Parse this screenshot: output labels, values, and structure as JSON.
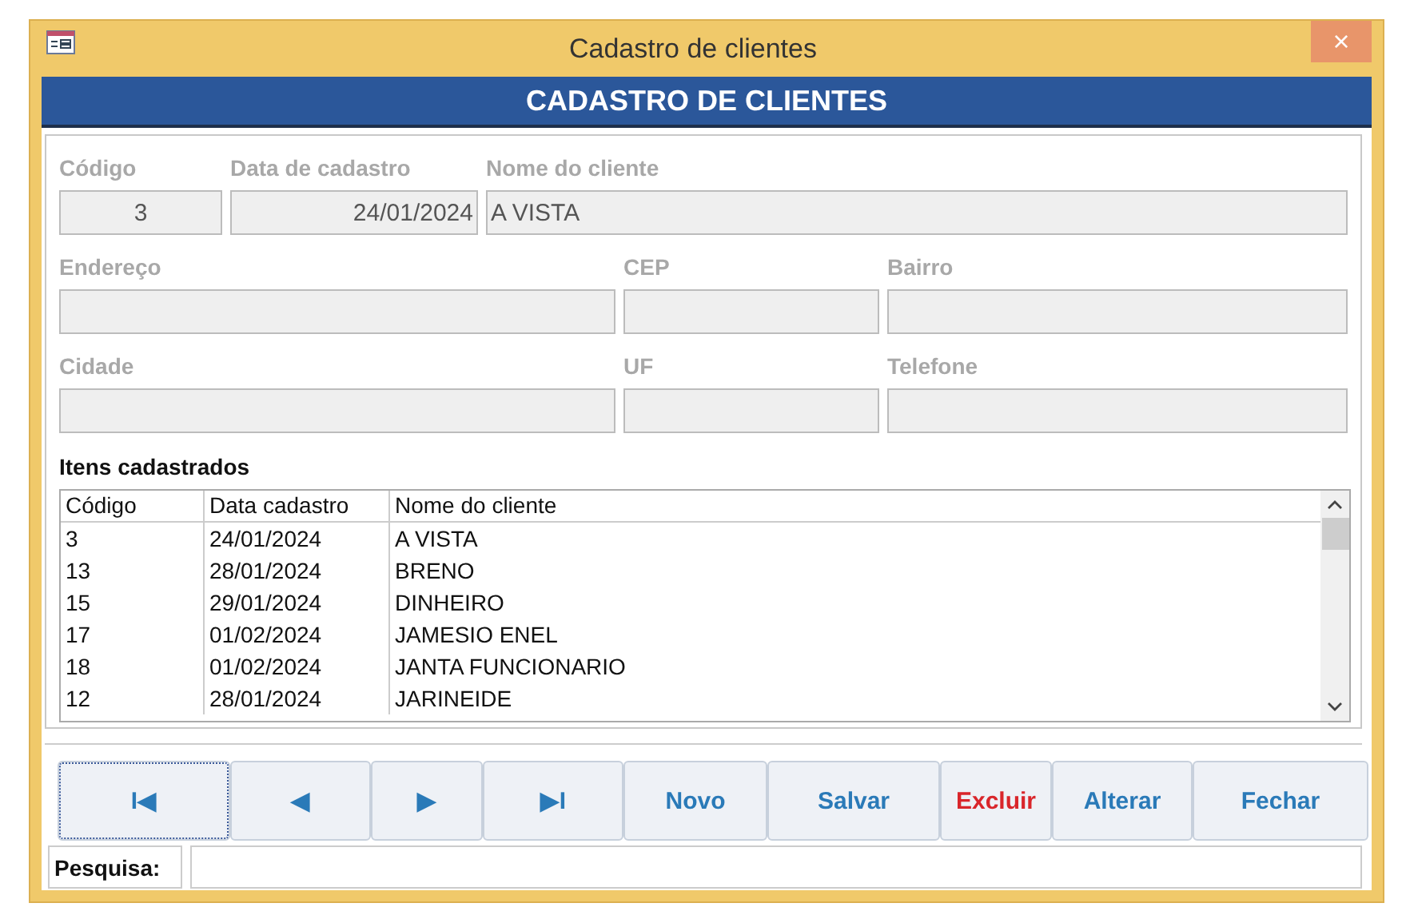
{
  "window": {
    "title": "Cadastro de clientes",
    "close": "×"
  },
  "header": "CADASTRO DE CLIENTES",
  "form": {
    "fields": [
      {
        "label": "Código",
        "value": "3",
        "disabled": true
      },
      {
        "label": "Data de cadastro",
        "value": "24/01/2024",
        "disabled": true
      },
      {
        "label": "Nome do cliente",
        "value": "A VISTA",
        "disabled": true
      },
      {
        "label": "Endereço",
        "disabled": true
      },
      {
        "label": "CEP",
        "disabled": true
      },
      {
        "label": "Bairro",
        "disabled": true
      },
      {
        "label": "Cidade",
        "disabled": true
      },
      {
        "label": "UF",
        "disabled": true
      },
      {
        "label": "Telefone",
        "disabled": true
      }
    ]
  },
  "list": {
    "title": "Itens cadastrados",
    "columns": [
      "Código",
      "Data cadastro",
      "Nome do cliente"
    ],
    "rows": [
      [
        "3",
        "24/01/2024",
        "A VISTA"
      ],
      [
        "13",
        "28/01/2024",
        "BRENO"
      ],
      [
        "15",
        "29/01/2024",
        "DINHEIRO"
      ],
      [
        "17",
        "01/02/2024",
        "JAMESIO ENEL"
      ],
      [
        "18",
        "01/02/2024",
        "JANTA FUNCIONARIO"
      ],
      [
        "12",
        "28/01/2024",
        "JARINEIDE"
      ]
    ]
  },
  "buttons": [
    {
      "label": "I◀",
      "kind": "nav",
      "focused": true
    },
    {
      "label": "◀",
      "kind": "nav",
      "focused": false
    },
    {
      "label": "▶",
      "kind": "nav",
      "focused": false
    },
    {
      "label": "▶I",
      "kind": "nav",
      "focused": false
    },
    {
      "label": "Novo",
      "kind": "action",
      "focused": false
    },
    {
      "label": "Salvar",
      "kind": "action",
      "focused": false
    },
    {
      "label": "Excluir",
      "kind": "danger",
      "focused": false
    },
    {
      "label": "Alterar",
      "kind": "action",
      "focused": false
    },
    {
      "label": "Fechar",
      "kind": "action",
      "focused": false
    }
  ],
  "search": {
    "label": "Pesquisa:"
  }
}
